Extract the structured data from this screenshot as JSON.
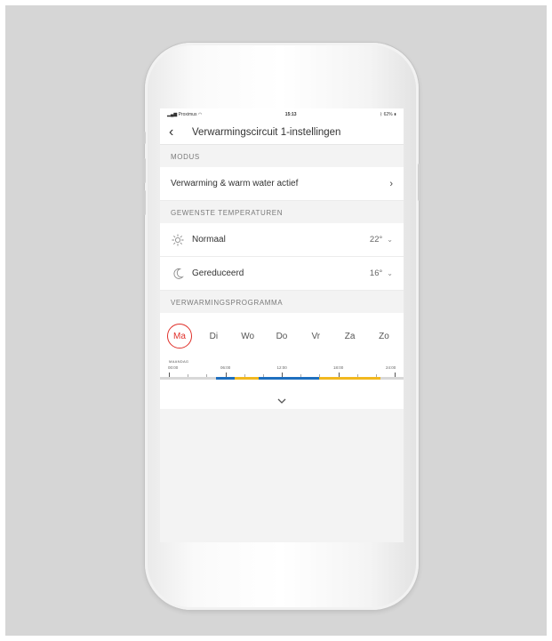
{
  "status_bar": {
    "carrier": "Proximus",
    "time": "15:13",
    "battery": "62%"
  },
  "header": {
    "title": "Verwarmingscircuit 1-instellingen"
  },
  "sections": {
    "mode": "MODUS",
    "temperatures": "GEWENSTE TEMPERATUREN",
    "program": "VERWARMINGSPROGRAMMA"
  },
  "mode": {
    "value": "Verwarming & warm water actief"
  },
  "temperatures": [
    {
      "label": "Normaal",
      "value": "22°",
      "icon": "sun-icon"
    },
    {
      "label": "Gereduceerd",
      "value": "16°",
      "icon": "moon-icon"
    }
  ],
  "days": [
    "Ma",
    "Di",
    "Wo",
    "Do",
    "Vr",
    "Za",
    "Zo"
  ],
  "selected_day": "Ma",
  "timeline": {
    "day_label": "MAANDAG",
    "times": [
      "00:00",
      "06:00",
      "12:00",
      "18:00",
      "24:00"
    ],
    "segments": [
      {
        "start": 5,
        "end": 7,
        "mode": "reduced"
      },
      {
        "start": 7,
        "end": 9.5,
        "mode": "normal"
      },
      {
        "start": 9.5,
        "end": 16,
        "mode": "reduced"
      },
      {
        "start": 16,
        "end": 22.5,
        "mode": "normal"
      }
    ]
  },
  "colors": {
    "accent": "#e0302a",
    "reduced": "#1e6fbf",
    "normal": "#f2b81f"
  }
}
